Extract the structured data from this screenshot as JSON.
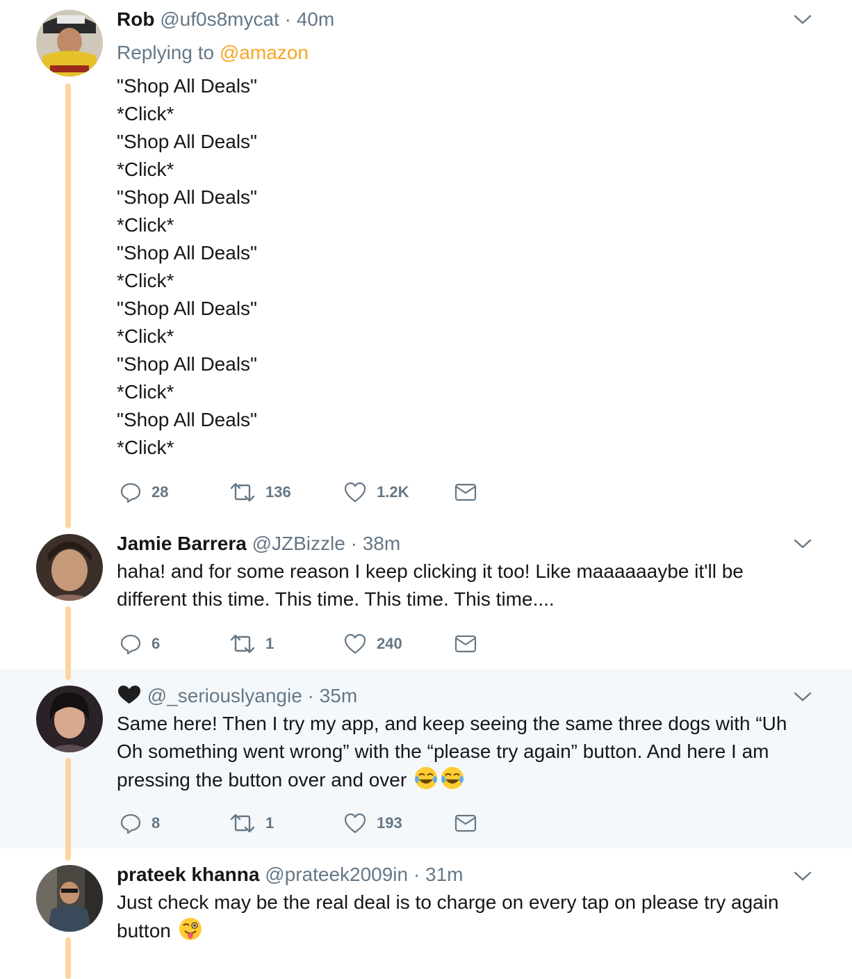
{
  "tweets": [
    {
      "name": "Rob",
      "handle": "@uf0s8mycat",
      "separator": "·",
      "time": "40m",
      "replying_prefix": "Replying to",
      "replying_to": "@amazon",
      "lines": [
        "\"Shop All Deals\"",
        "*Click*",
        "\"Shop All Deals\"",
        "*Click*",
        "\"Shop All Deals\"",
        "*Click*",
        "\"Shop All Deals\"",
        "*Click*",
        "\"Shop All Deals\"",
        "*Click*",
        "\"Shop All Deals\"",
        "*Click*",
        "\"Shop All Deals\"",
        "*Click*"
      ],
      "replies": "28",
      "retweets": "136",
      "likes": "1.2K"
    },
    {
      "name": "Jamie Barrera",
      "handle": "@JZBizzle",
      "separator": "·",
      "time": "38m",
      "text": "haha! and for some reason I keep clicking it too! Like maaaaaaybe it'll be different this time. This time. This time. This time....",
      "replies": "6",
      "retweets": "1",
      "likes": "240"
    },
    {
      "name": "",
      "name_icon": "black-heart-icon",
      "handle": "@_seriouslyangie",
      "separator": "·",
      "time": "35m",
      "text": "Same here! Then I try my app, and keep seeing the same three dogs with “Uh Oh something went wrong” with the “please try again” button. And here I am pressing the button over and over",
      "emoji": "tears-of-joy-emoji",
      "replies": "8",
      "retweets": "1",
      "likes": "193"
    },
    {
      "name": "prateek khanna",
      "handle": "@prateek2009in",
      "separator": "·",
      "time": "31m",
      "text": "Just check may be the real deal is to charge on every tap on please try again button",
      "emoji": "winking-tongue-emoji"
    }
  ],
  "colors": {
    "thread_line": "#fdd5a1",
    "mention": "#f5a623",
    "muted": "#657786",
    "highlight_bg": "#f5f8fa"
  }
}
